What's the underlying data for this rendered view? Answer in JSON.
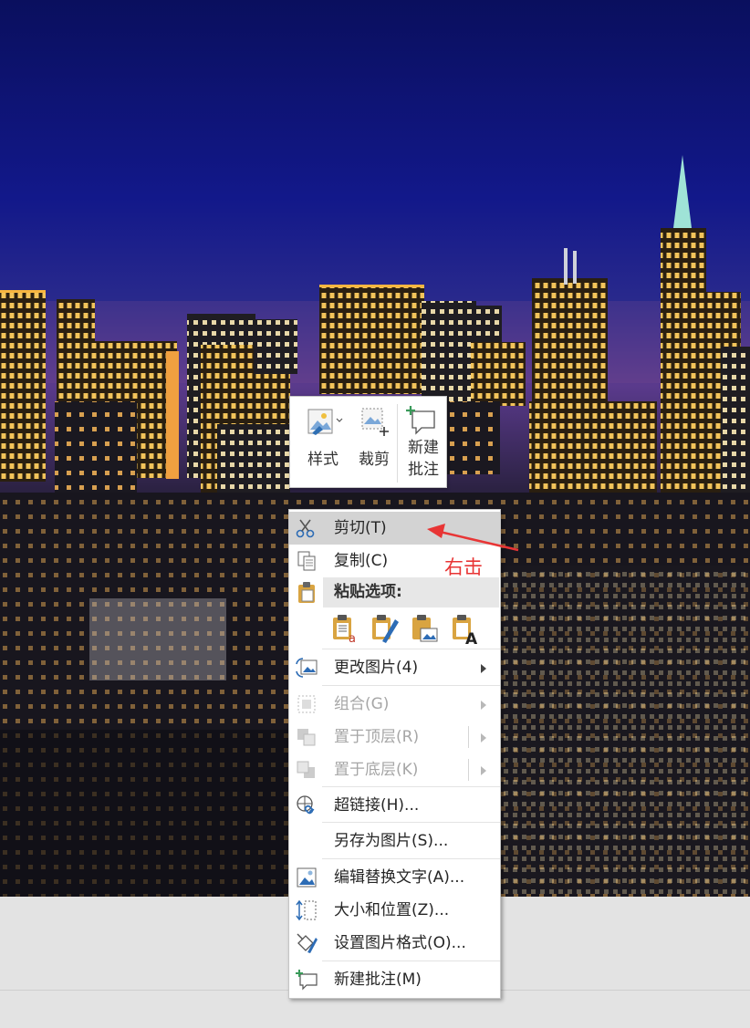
{
  "mini_toolbar": {
    "style_label": "样式",
    "crop_label": "裁剪",
    "new_note_line1": "新建",
    "new_note_line2": "批注"
  },
  "context_menu": {
    "items": [
      {
        "label": "剪切(T)",
        "icon": "scissors-icon",
        "highlighted": true
      },
      {
        "label": "复制(C)",
        "icon": "copy-icon"
      },
      {
        "label": "粘贴选项:",
        "icon": "paste-icon",
        "header": true
      },
      {
        "label": "更改图片(4)",
        "icon": "change-picture-icon",
        "submenu": true
      },
      {
        "label": "组合(G)",
        "icon": "group-icon",
        "submenu": true,
        "disabled": true
      },
      {
        "label": "置于顶层(R)",
        "icon": "bring-to-front-icon",
        "submenu": true,
        "disabled": true
      },
      {
        "label": "置于底层(K)",
        "icon": "send-to-back-icon",
        "submenu": true,
        "disabled": true
      },
      {
        "label": "超链接(H)...",
        "icon": "hyperlink-icon"
      },
      {
        "label": "另存为图片(S)...",
        "icon": ""
      },
      {
        "label": "编辑替换文字(A)...",
        "icon": "alt-text-icon"
      },
      {
        "label": "大小和位置(Z)...",
        "icon": "size-position-icon"
      },
      {
        "label": "设置图片格式(O)...",
        "icon": "format-picture-icon"
      },
      {
        "label": "新建批注(M)",
        "icon": "new-comment-icon"
      }
    ],
    "paste_options": [
      "paste-keep-formatting-icon",
      "paste-picture-format-icon",
      "paste-as-picture-icon",
      "paste-text-only-icon"
    ]
  },
  "annotation": {
    "text": "右击",
    "color": "#e83535"
  }
}
